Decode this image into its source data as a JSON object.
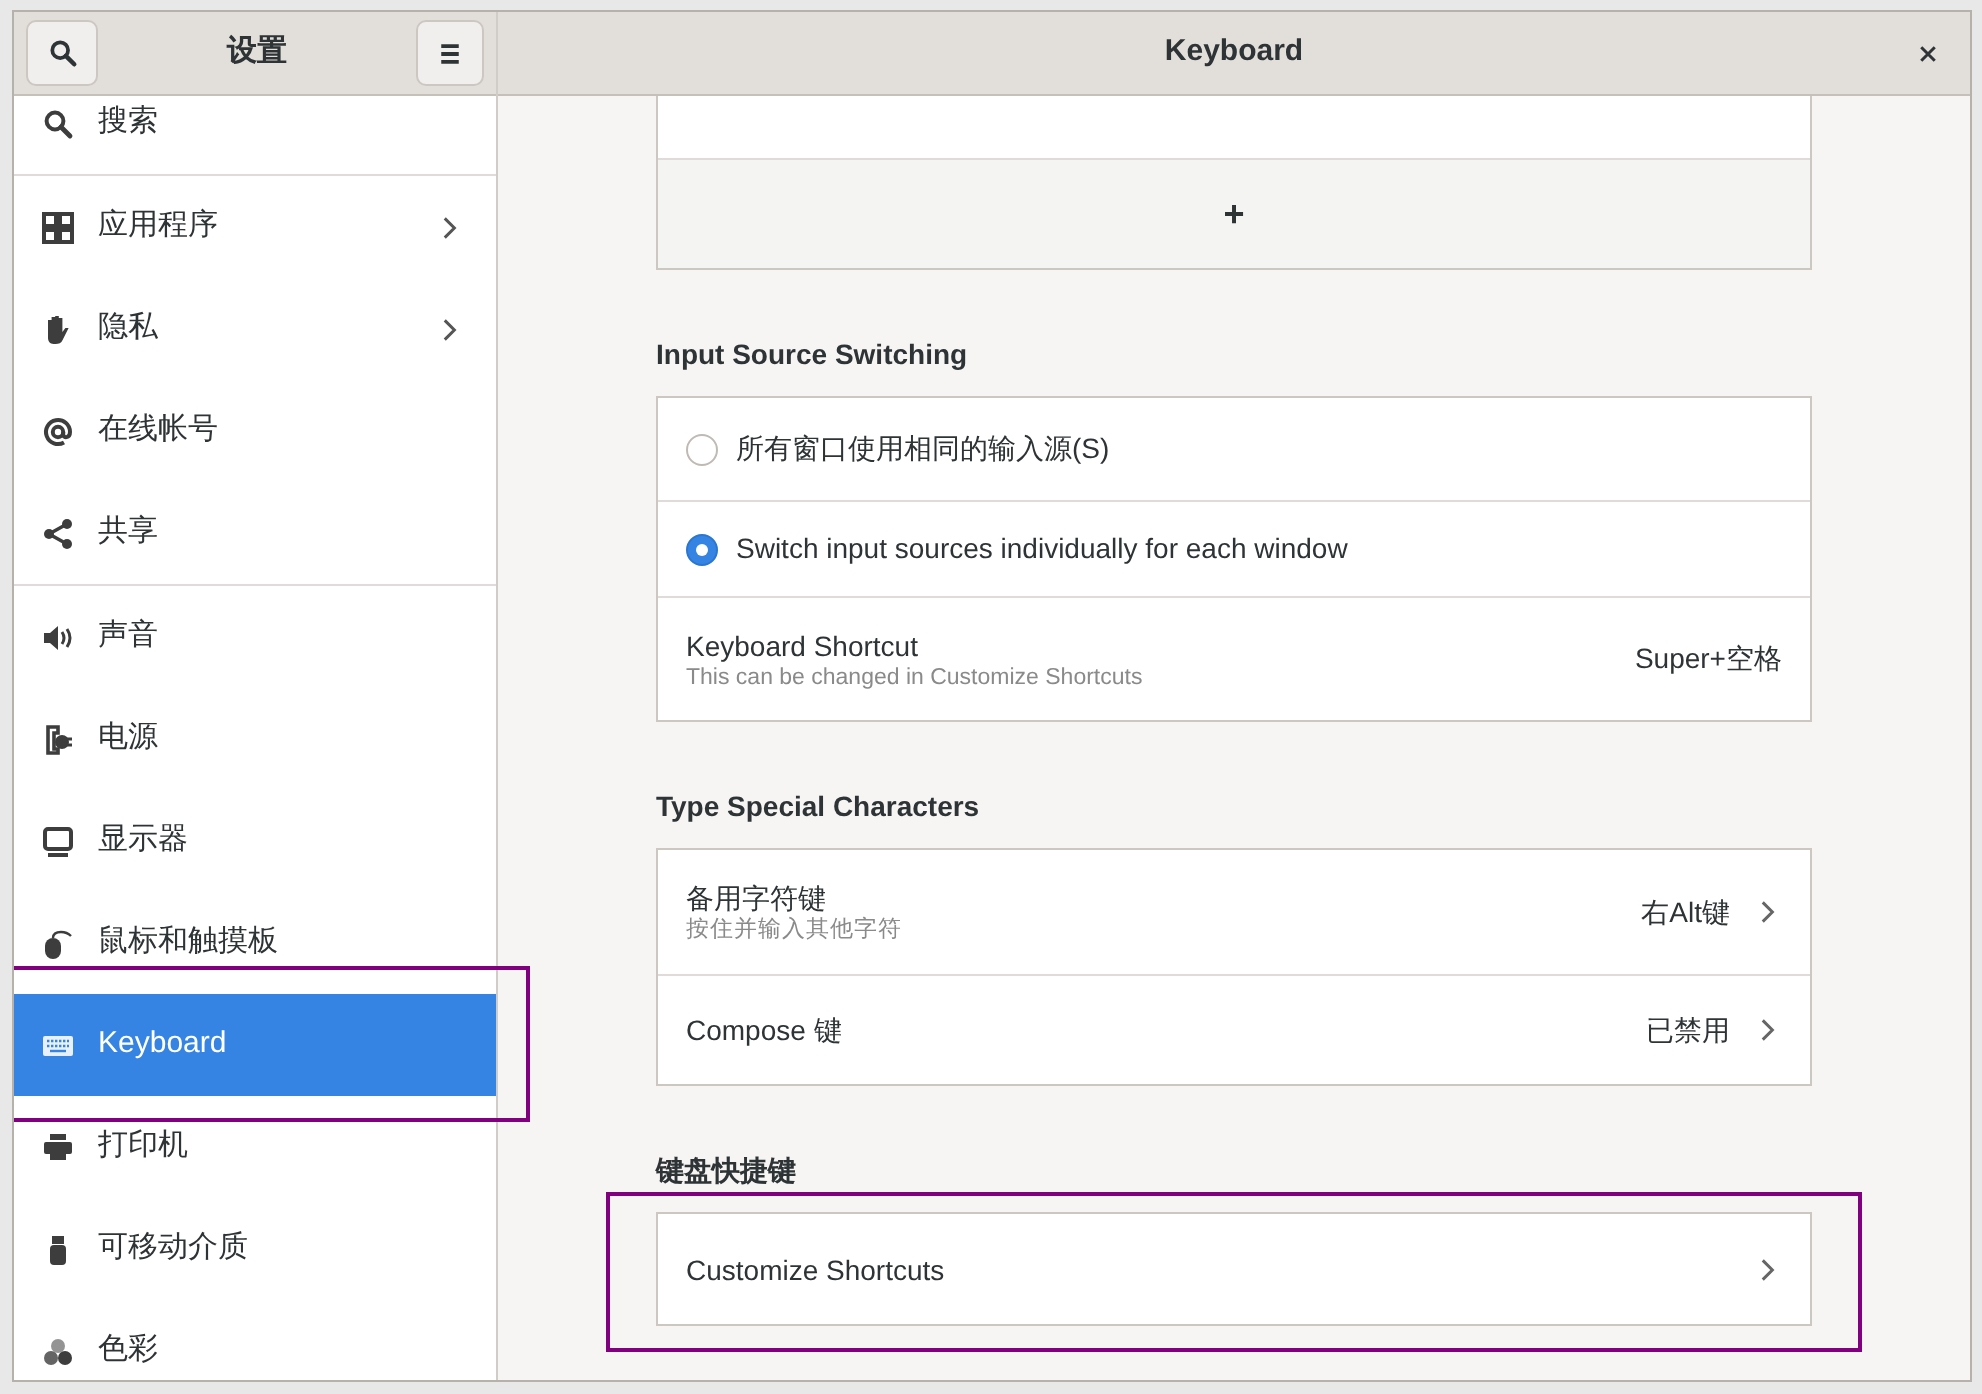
{
  "sidebar": {
    "title": "设置",
    "groups": [
      [
        {
          "label": "搜索",
          "has_submenu": false,
          "selected": false,
          "highlighted": false
        }
      ],
      [
        {
          "label": "应用程序",
          "has_submenu": true,
          "selected": false,
          "highlighted": false
        },
        {
          "label": "隐私",
          "has_submenu": true,
          "selected": false,
          "highlighted": false
        },
        {
          "label": "在线帐号",
          "has_submenu": false,
          "selected": false,
          "highlighted": false
        },
        {
          "label": "共享",
          "has_submenu": false,
          "selected": false,
          "highlighted": false
        }
      ],
      [
        {
          "label": "声音",
          "has_submenu": false,
          "selected": false,
          "highlighted": false
        },
        {
          "label": "电源",
          "has_submenu": false,
          "selected": false,
          "highlighted": false
        },
        {
          "label": "显示器",
          "has_submenu": false,
          "selected": false,
          "highlighted": false
        },
        {
          "label": "鼠标和触摸板",
          "has_submenu": false,
          "selected": false,
          "highlighted": false
        },
        {
          "label": "Keyboard",
          "has_submenu": false,
          "selected": true,
          "highlighted": true
        },
        {
          "label": "打印机",
          "has_submenu": false,
          "selected": false,
          "highlighted": false
        },
        {
          "label": "可移动介质",
          "has_submenu": false,
          "selected": false,
          "highlighted": false
        },
        {
          "label": "色彩",
          "has_submenu": false,
          "selected": false,
          "highlighted": false
        }
      ]
    ]
  },
  "panel": {
    "title": "Keyboard"
  },
  "input_sources": {
    "add_label": "+"
  },
  "sections": [
    {
      "heading": "Input Source Switching",
      "highlighted": false,
      "rows": [
        {
          "kind": "radio",
          "label": "所有窗口使用相同的输入源(S)",
          "selected": false
        },
        {
          "kind": "radio",
          "label": "Switch input sources individually for each window",
          "selected": true
        },
        {
          "kind": "value",
          "label": "Keyboard Shortcut",
          "subtitle": "This can be changed in Customize Shortcuts",
          "value": "Super+空格",
          "chevron": false
        }
      ]
    },
    {
      "heading": "Type Special Characters",
      "highlighted": false,
      "rows": [
        {
          "kind": "value",
          "label": "备用字符键",
          "subtitle": "按住并输入其他字符",
          "value": "右Alt键",
          "chevron": true
        },
        {
          "kind": "value",
          "label": "Compose 键",
          "value": "已禁用",
          "chevron": true
        }
      ]
    },
    {
      "heading": "键盘快捷键",
      "highlighted": true,
      "rows": [
        {
          "kind": "value",
          "label": "Customize Shortcuts",
          "chevron": true
        }
      ]
    }
  ]
}
